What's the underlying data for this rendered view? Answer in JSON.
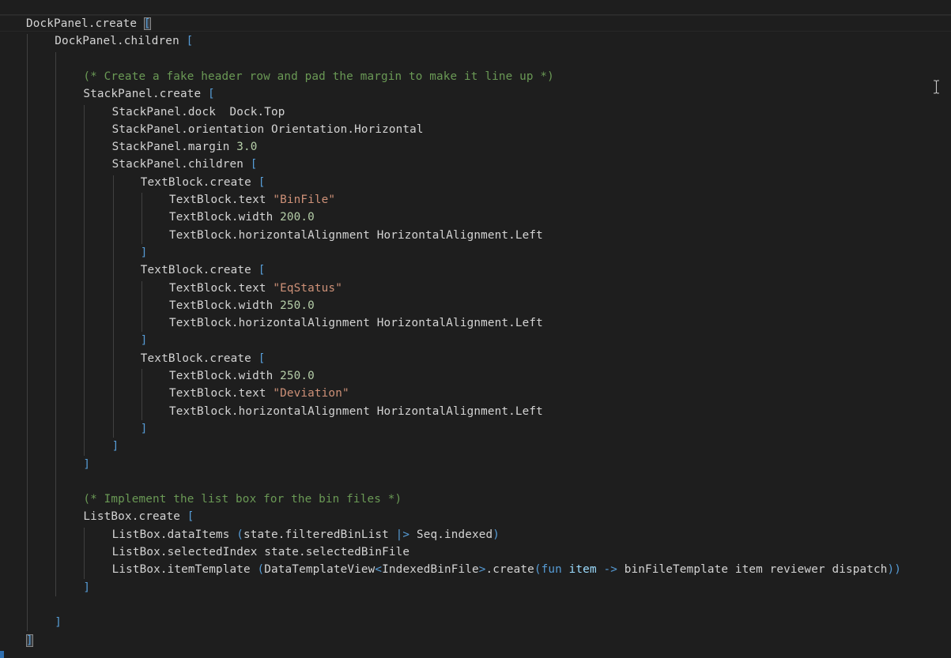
{
  "editor": {
    "language": "F#",
    "lines": [
      {
        "indent": 0,
        "tokens": [
          [
            "plain",
            "DockPanel.create "
          ],
          [
            "match",
            "["
          ]
        ]
      },
      {
        "indent": 1,
        "tokens": [
          [
            "plain",
            "DockPanel.children "
          ],
          [
            "bracket",
            "["
          ]
        ]
      },
      {
        "indent": 2,
        "tokens": []
      },
      {
        "indent": 2,
        "tokens": [
          [
            "comment",
            "(* Create a fake header row and pad the margin to make it line up *)"
          ]
        ]
      },
      {
        "indent": 2,
        "tokens": [
          [
            "plain",
            "StackPanel.create "
          ],
          [
            "bracket",
            "["
          ]
        ]
      },
      {
        "indent": 3,
        "tokens": [
          [
            "plain",
            "StackPanel.dock  Dock.Top"
          ]
        ]
      },
      {
        "indent": 3,
        "tokens": [
          [
            "plain",
            "StackPanel.orientation Orientation.Horizontal"
          ]
        ]
      },
      {
        "indent": 3,
        "tokens": [
          [
            "plain",
            "StackPanel.margin "
          ],
          [
            "number",
            "3.0"
          ]
        ]
      },
      {
        "indent": 3,
        "tokens": [
          [
            "plain",
            "StackPanel.children "
          ],
          [
            "bracket",
            "["
          ]
        ]
      },
      {
        "indent": 4,
        "tokens": [
          [
            "plain",
            "TextBlock.create "
          ],
          [
            "bracket",
            "["
          ]
        ]
      },
      {
        "indent": 5,
        "tokens": [
          [
            "plain",
            "TextBlock.text "
          ],
          [
            "string",
            "\"BinFile\""
          ]
        ]
      },
      {
        "indent": 5,
        "tokens": [
          [
            "plain",
            "TextBlock.width "
          ],
          [
            "number",
            "200.0"
          ]
        ]
      },
      {
        "indent": 5,
        "tokens": [
          [
            "plain",
            "TextBlock.horizontalAlignment HorizontalAlignment.Left"
          ]
        ]
      },
      {
        "indent": 4,
        "tokens": [
          [
            "bracket",
            "]"
          ]
        ]
      },
      {
        "indent": 4,
        "tokens": [
          [
            "plain",
            "TextBlock.create "
          ],
          [
            "bracket",
            "["
          ]
        ]
      },
      {
        "indent": 5,
        "tokens": [
          [
            "plain",
            "TextBlock.text "
          ],
          [
            "string",
            "\"EqStatus\""
          ]
        ]
      },
      {
        "indent": 5,
        "tokens": [
          [
            "plain",
            "TextBlock.width "
          ],
          [
            "number",
            "250.0"
          ]
        ]
      },
      {
        "indent": 5,
        "tokens": [
          [
            "plain",
            "TextBlock.horizontalAlignment HorizontalAlignment.Left"
          ]
        ]
      },
      {
        "indent": 4,
        "tokens": [
          [
            "bracket",
            "]"
          ]
        ]
      },
      {
        "indent": 4,
        "tokens": [
          [
            "plain",
            "TextBlock.create "
          ],
          [
            "bracket",
            "["
          ]
        ]
      },
      {
        "indent": 5,
        "tokens": [
          [
            "plain",
            "TextBlock.width "
          ],
          [
            "number",
            "250.0"
          ]
        ]
      },
      {
        "indent": 5,
        "tokens": [
          [
            "plain",
            "TextBlock.text "
          ],
          [
            "string",
            "\"Deviation\""
          ]
        ]
      },
      {
        "indent": 5,
        "tokens": [
          [
            "plain",
            "TextBlock.horizontalAlignment HorizontalAlignment.Left"
          ]
        ]
      },
      {
        "indent": 4,
        "tokens": [
          [
            "bracket",
            "]"
          ]
        ]
      },
      {
        "indent": 3,
        "tokens": [
          [
            "bracket",
            "]"
          ]
        ]
      },
      {
        "indent": 2,
        "tokens": [
          [
            "bracket",
            "]"
          ]
        ]
      },
      {
        "indent": 2,
        "tokens": []
      },
      {
        "indent": 2,
        "tokens": [
          [
            "comment",
            "(* Implement the list box for the bin files *)"
          ]
        ]
      },
      {
        "indent": 2,
        "tokens": [
          [
            "plain",
            "ListBox.create "
          ],
          [
            "bracket",
            "["
          ]
        ]
      },
      {
        "indent": 3,
        "tokens": [
          [
            "plain",
            "ListBox.dataItems "
          ],
          [
            "bracket",
            "("
          ],
          [
            "plain",
            "state.filteredBinList "
          ],
          [
            "op",
            "|>"
          ],
          [
            "plain",
            " Seq.indexed"
          ],
          [
            "bracket",
            ")"
          ]
        ]
      },
      {
        "indent": 3,
        "tokens": [
          [
            "plain",
            "ListBox.selectedIndex state.selectedBinFile"
          ]
        ]
      },
      {
        "indent": 3,
        "tokens": [
          [
            "plain",
            "ListBox.itemTemplate "
          ],
          [
            "bracket",
            "("
          ],
          [
            "plain",
            "DataTemplateView"
          ],
          [
            "op",
            "<"
          ],
          [
            "plain",
            "IndexedBinFile"
          ],
          [
            "op",
            ">"
          ],
          [
            "plain",
            ".create"
          ],
          [
            "bracket",
            "("
          ],
          [
            "keyword",
            "fun"
          ],
          [
            "plain",
            " "
          ],
          [
            "var",
            "item"
          ],
          [
            "plain",
            " "
          ],
          [
            "op",
            "->"
          ],
          [
            "plain",
            " binFileTemplate item reviewer dispatch"
          ],
          [
            "bracket",
            "))"
          ]
        ]
      },
      {
        "indent": 2,
        "tokens": [
          [
            "bracket",
            "]"
          ]
        ]
      },
      {
        "indent": 1,
        "tokens": []
      },
      {
        "indent": 1,
        "tokens": [
          [
            "bracket",
            "]"
          ]
        ]
      },
      {
        "indent": 0,
        "tokens": [
          [
            "match",
            "]"
          ]
        ]
      }
    ],
    "colors": {
      "background": "#1e1e1e",
      "plain": "#d4d4d4",
      "bracket": "#569cd6",
      "comment": "#6a9955",
      "string": "#ce9178",
      "number": "#b5cea8",
      "keyword": "#569cd6",
      "variable": "#9cdcfe"
    },
    "mouse_cursor": "text-cursor-icon"
  }
}
